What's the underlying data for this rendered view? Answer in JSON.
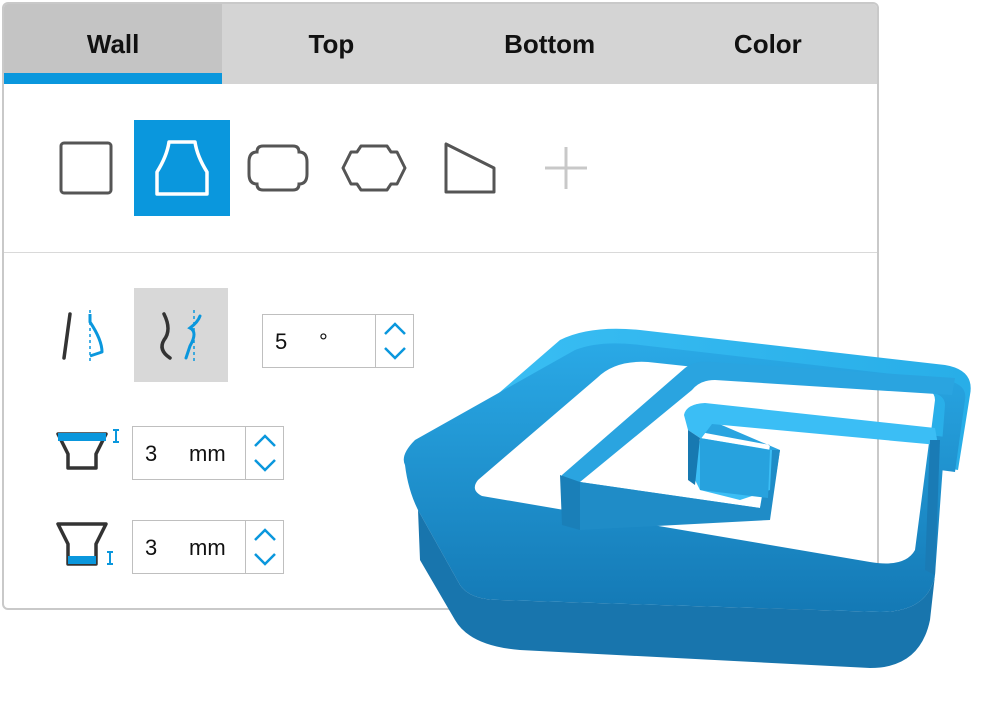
{
  "tabs": [
    {
      "label": "Wall",
      "active": true
    },
    {
      "label": "Top",
      "active": false
    },
    {
      "label": "Bottom",
      "active": false
    },
    {
      "label": "Color",
      "active": false
    }
  ],
  "shapes": [
    {
      "name": "square",
      "selected": false
    },
    {
      "name": "trapezoid",
      "selected": true
    },
    {
      "name": "rounded-cross",
      "selected": false
    },
    {
      "name": "chamfer-cross",
      "selected": false
    },
    {
      "name": "slant",
      "selected": false
    },
    {
      "name": "add",
      "selected": false
    }
  ],
  "draft": {
    "modes": [
      {
        "name": "draft-straight",
        "selected": false
      },
      {
        "name": "draft-curved",
        "selected": true
      }
    ],
    "angle": {
      "value": "5",
      "unit": "°"
    }
  },
  "top_thickness": {
    "value": "3",
    "unit": "mm"
  },
  "bottom_thickness": {
    "value": "3",
    "unit": "mm"
  },
  "colors": {
    "accent": "#0a97dd",
    "tab_bar": "#d4d4d4",
    "model": "#1f9fdc"
  }
}
